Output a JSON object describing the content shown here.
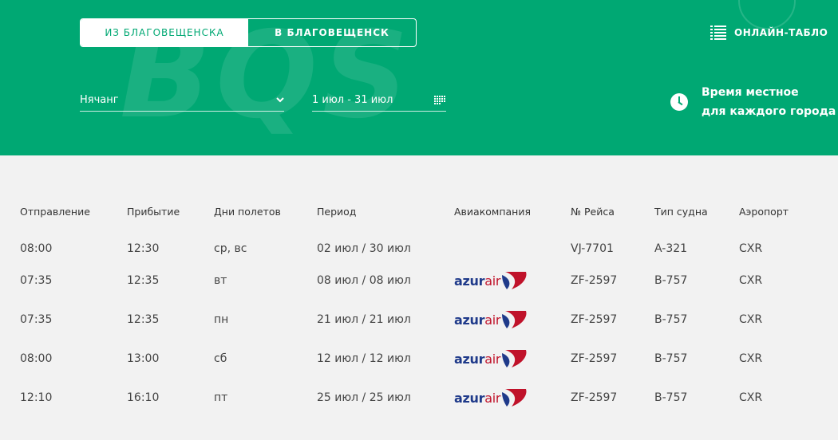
{
  "header": {
    "watermark": "BQS",
    "tabs": [
      {
        "label": "ИЗ БЛАГОВЕЩЕНСКА",
        "active": true
      },
      {
        "label": "В БЛАГОВЕЩЕНСК",
        "active": false
      }
    ],
    "online_board": "ОНЛАЙН-ТАБЛО",
    "city": "Нячанг",
    "date_range": "1 июл - 31 июл",
    "timezone_line1": "Время местное",
    "timezone_line2": "для каждого города"
  },
  "colors": {
    "brand": "#00a873",
    "azur_blue": "#1f3a8a",
    "azur_red": "#c0122a"
  },
  "table": {
    "columns": [
      "Отправление",
      "Прибытие",
      "Дни полетов",
      "Период",
      "Авиакомпания",
      "№ Рейса",
      "Тип судна",
      "Аэропорт"
    ],
    "rows": [
      {
        "dep": "08:00",
        "arr": "12:30",
        "days": "ср, вс",
        "period": "02 июл / 30 июл",
        "airline": "",
        "flight": "VJ-7701",
        "aircraft": "A-321",
        "airport": "CXR"
      },
      {
        "dep": "07:35",
        "arr": "12:35",
        "days": "вт",
        "period": "08 июл / 08 июл",
        "airline": "azurair",
        "flight": "ZF-2597",
        "aircraft": "B-757",
        "airport": "CXR"
      },
      {
        "dep": "07:35",
        "arr": "12:35",
        "days": "пн",
        "period": "21 июл / 21 июл",
        "airline": "azurair",
        "flight": "ZF-2597",
        "aircraft": "B-757",
        "airport": "CXR"
      },
      {
        "dep": "08:00",
        "arr": "13:00",
        "days": "сб",
        "period": "12 июл / 12 июл",
        "airline": "azurair",
        "flight": "ZF-2597",
        "aircraft": "B-757",
        "airport": "CXR"
      },
      {
        "dep": "12:10",
        "arr": "16:10",
        "days": "пт",
        "period": "25 июл / 25 июл",
        "airline": "azurair",
        "flight": "ZF-2597",
        "aircraft": "B-757",
        "airport": "CXR"
      }
    ]
  }
}
